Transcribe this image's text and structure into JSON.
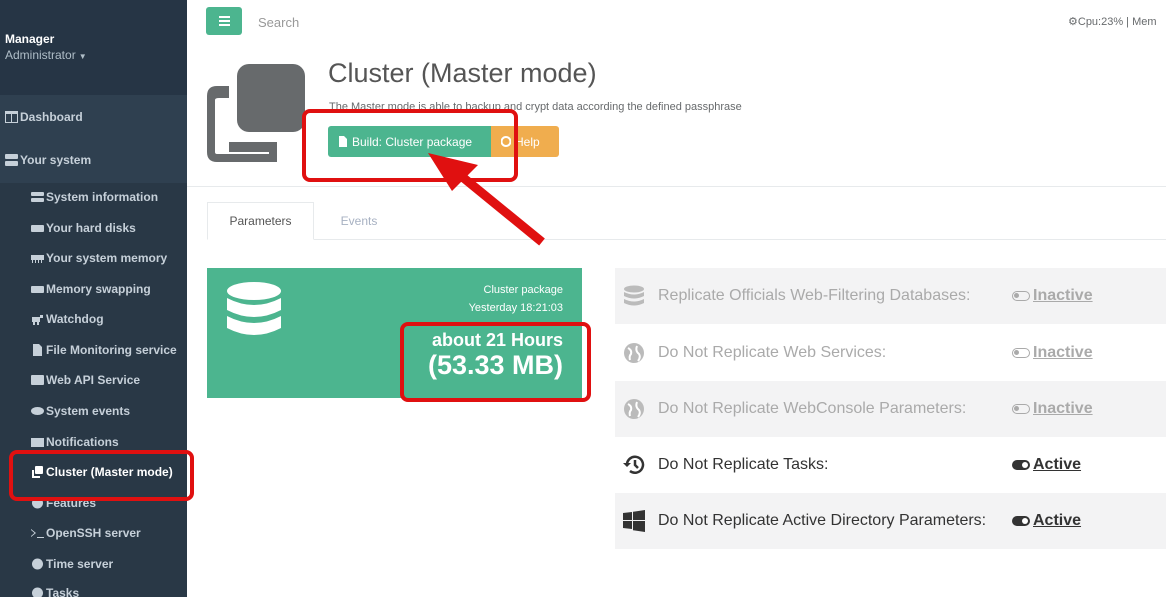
{
  "profile": {
    "name": "Manager",
    "role": "Administrator"
  },
  "nav": {
    "dashboard": "Dashboard",
    "your_system": "Your system",
    "sub_items": [
      {
        "label": "System information",
        "icon": "server-icon"
      },
      {
        "label": "Your hard disks",
        "icon": "hdd-icon"
      },
      {
        "label": "Your system memory",
        "icon": "memory-icon"
      },
      {
        "label": "Memory swapping",
        "icon": "hdd-icon"
      },
      {
        "label": "Watchdog",
        "icon": "dog-icon"
      },
      {
        "label": "File Monitoring service",
        "icon": "file-icon"
      },
      {
        "label": "Web API Service",
        "icon": "api-icon"
      },
      {
        "label": "System events",
        "icon": "eye-icon"
      },
      {
        "label": "Notifications",
        "icon": "envelope-icon"
      },
      {
        "label": "Cluster (Master mode)",
        "icon": "copy-icon"
      },
      {
        "label": "Features",
        "icon": "features-icon"
      },
      {
        "label": "OpenSSH server",
        "icon": "terminal-icon"
      },
      {
        "label": "Time server",
        "icon": "clock-icon"
      },
      {
        "label": "Tasks",
        "icon": "clock-icon"
      }
    ]
  },
  "topbar": {
    "search_placeholder": "Search",
    "sysinfo": "Cpu:23% | Mem"
  },
  "header": {
    "title": "Cluster (Master mode)",
    "description": "The Master mode is able to backup and crypt data according the defined passphrase",
    "build_button": "Build: Cluster package",
    "help_button": "Help"
  },
  "tabs": {
    "parameters": "Parameters",
    "events": "Events"
  },
  "widget": {
    "label": "Cluster package",
    "date": "Yesterday 18:21:03",
    "duration": "about 21 Hours",
    "size": "(53.33 MB)"
  },
  "parameters": [
    {
      "label": "Replicate Officials Web-Filtering Databases:",
      "status": "Inactive",
      "icon": "database-icon"
    },
    {
      "label": "Do Not Replicate Web Services:",
      "status": "Inactive",
      "icon": "globe-icon"
    },
    {
      "label": "Do Not Replicate WebConsole Parameters:",
      "status": "Inactive",
      "icon": "globe-icon"
    },
    {
      "label": "Do Not Replicate Tasks:",
      "status": "Active",
      "icon": "history-icon"
    },
    {
      "label": "Do Not Replicate Active Directory Parameters:",
      "status": "Active",
      "icon": "windows-icon"
    }
  ],
  "colors": {
    "sidebar": "#2f4050",
    "accent": "#4cb58f",
    "warning": "#f0ad4e",
    "annotation": "#e01010"
  }
}
